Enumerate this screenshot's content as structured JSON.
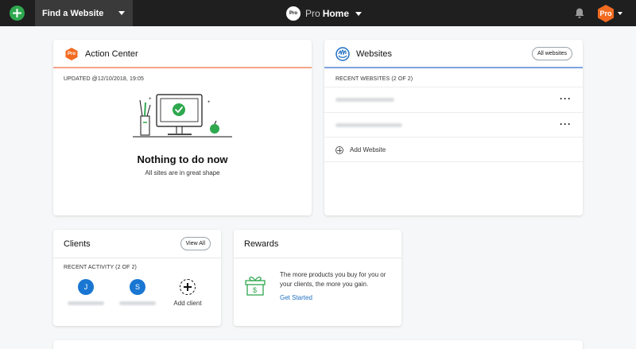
{
  "topbar": {
    "find_website": "Find a Website",
    "brand_logo": "Pro",
    "brand_pro": "Pro",
    "brand_home": "Home",
    "avatar_label": "Pro"
  },
  "action_center": {
    "badge": "Pro",
    "title": "Action Center",
    "updated": "UPDATED @12/10/2018, 19:05",
    "heading": "Nothing to do now",
    "subtext": "All sites are in great shape"
  },
  "websites": {
    "title": "Websites",
    "all_button": "All websites",
    "recent_label": "RECENT WEBSITES (2 OF 2)",
    "add_label": "Add Website"
  },
  "clients": {
    "title": "Clients",
    "view_all": "View All",
    "recent_label": "RECENT ACTIVITY (2 OF 2)",
    "items": [
      {
        "initial": "J"
      },
      {
        "initial": "S"
      }
    ],
    "add_label": "Add client"
  },
  "rewards": {
    "title": "Rewards",
    "text": "The more products you buy for you or your clients, the more you gain.",
    "link": "Get Started"
  },
  "colors": {
    "topbar": "#1f1f1f",
    "add_green": "#2fa84f",
    "pro_orange": "#f26b21",
    "link_blue": "#1f6fc2",
    "client_blue": "#1976d2"
  }
}
